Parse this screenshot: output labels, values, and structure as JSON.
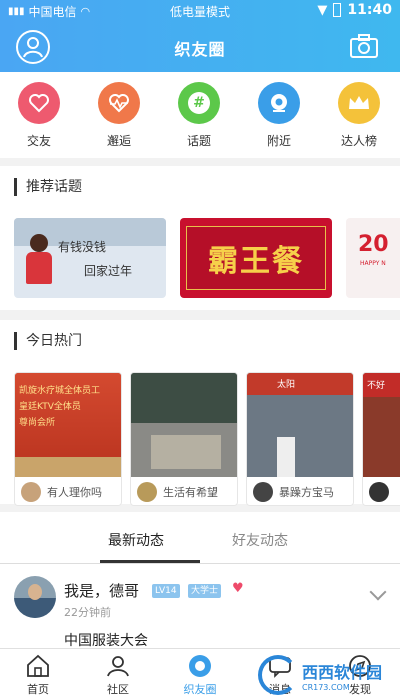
{
  "status_bar": {
    "carrier": "中国电信",
    "mode": "低电量模式",
    "time": "11:40"
  },
  "header": {
    "title": "织友圈",
    "left_icon": "avatar-icon",
    "right_icon": "camera-icon",
    "gradient_colors": [
      "#4aa6f3",
      "#3fb8ef"
    ]
  },
  "quick_actions": [
    {
      "label": "交友",
      "icon": "heart-icon",
      "color": "#ee5a6f"
    },
    {
      "label": "邂逅",
      "icon": "heartbeat-icon",
      "color": "#f0784a"
    },
    {
      "label": "话题",
      "icon": "hashtag-icon",
      "color": "#5cc84a"
    },
    {
      "label": "附近",
      "icon": "location-icon",
      "color": "#3a9ee8"
    },
    {
      "label": "达人榜",
      "icon": "crown-icon",
      "color": "#f4c23a"
    }
  ],
  "recommended": {
    "title": "推荐话题",
    "topics": [
      {
        "text_line1": "有钱没钱",
        "text_line2": "回家过年"
      },
      {
        "text": "霸王餐"
      },
      {
        "text": "20",
        "subtext": "HAPPY N"
      }
    ]
  },
  "hot_today": {
    "title": "今日热门",
    "items": [
      {
        "caption": "有人理你吗",
        "image_lines": [
          "凯旋水疗城全体员工",
          "皇廷KTV全体员",
          "尊尚会所"
        ]
      },
      {
        "caption": "生活有希望"
      },
      {
        "caption": "暴躁方宝马",
        "image_text": "太阳"
      },
      {
        "caption": "",
        "image_text": "不好"
      }
    ]
  },
  "tabs": [
    {
      "label": "最新动态",
      "active": true
    },
    {
      "label": "好友动态",
      "active": false
    }
  ],
  "feed": [
    {
      "username": "我是，德哥",
      "badges": [
        "LV14",
        "大学士"
      ],
      "time": "22分钟前",
      "content": "中国服装大会"
    }
  ],
  "bottom_nav": [
    {
      "label": "首页",
      "icon": "home-icon"
    },
    {
      "label": "社区",
      "icon": "community-icon"
    },
    {
      "label": "织友圈",
      "icon": "circle-icon",
      "active": true
    },
    {
      "label": "消息",
      "icon": "message-icon"
    },
    {
      "label": "发现",
      "icon": "discover-icon"
    }
  ],
  "watermark": {
    "text": "西西软件园",
    "sub": "CR173.COM"
  }
}
